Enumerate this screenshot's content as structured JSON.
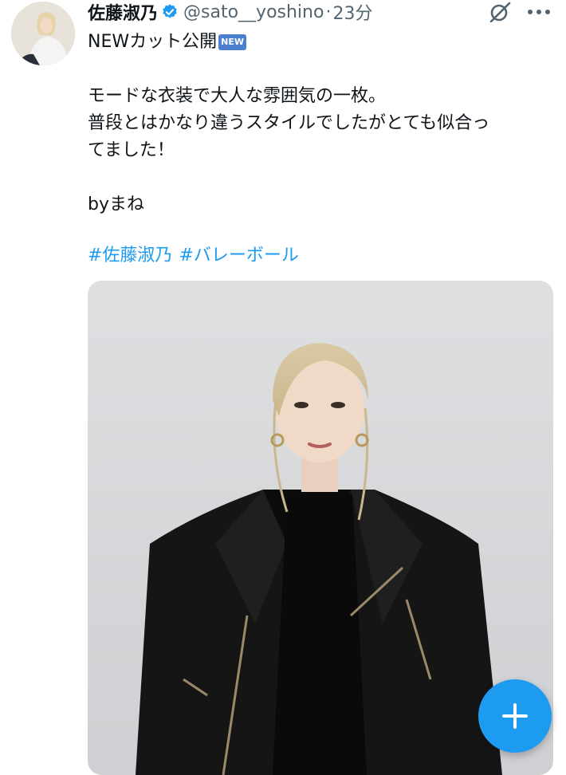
{
  "author": {
    "display_name": "佐藤淑乃",
    "handle": "@sato__yoshino",
    "time_separator": "·",
    "time": "23分",
    "verified_icon": "verified-badge-icon"
  },
  "tweet": {
    "line1": "NEWカット公開",
    "new_badge": "NEW",
    "line2": "モードな衣装で大人な雰囲気の一枚。",
    "line3": "普段とはかなり違うスタイルでしたがとても似合っ",
    "line4": "てました！",
    "line5": "byまね",
    "hashtags": [
      "#佐藤淑乃",
      "#バレーボール"
    ]
  },
  "colors": {
    "link": "#1d9bf0",
    "compose_button": "#1d9bf0",
    "muted": "#536471"
  },
  "icons": {
    "grok": "grok-icon",
    "more": "more-icon",
    "compose": "plus-icon"
  }
}
